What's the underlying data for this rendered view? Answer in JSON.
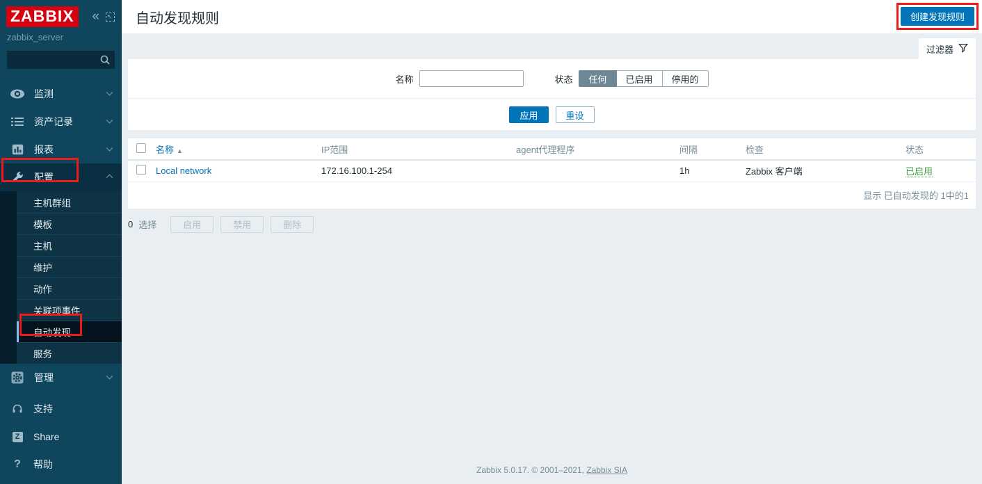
{
  "colors": {
    "sidebar_bg": "#10455e",
    "accent_blue": "#0275b8",
    "logo_red": "#d6000f",
    "annotation_red": "#ec1c1c",
    "enabled_green": "#429e42",
    "page_bg": "#e8eef1"
  },
  "sidebar": {
    "logo": "ZABBIX",
    "server_name": "zabbix_server",
    "items": [
      {
        "label": "监测"
      },
      {
        "label": "资产记录"
      },
      {
        "label": "报表"
      },
      {
        "label": "配置"
      },
      {
        "label": "管理"
      }
    ],
    "config_submenu": [
      {
        "label": "主机群组"
      },
      {
        "label": "模板"
      },
      {
        "label": "主机"
      },
      {
        "label": "维护"
      },
      {
        "label": "动作"
      },
      {
        "label": "关联项事件"
      },
      {
        "label": "自动发现"
      },
      {
        "label": "服务"
      }
    ],
    "footer_items": [
      {
        "label": "支持"
      },
      {
        "label": "Share"
      },
      {
        "label": "帮助"
      }
    ]
  },
  "header": {
    "title": "自动发现规则",
    "create_button": "创建发现规则"
  },
  "filter": {
    "tab_label": "过滤器",
    "name_label": "名称",
    "name_value": "",
    "status_label": "状态",
    "status_options": [
      {
        "label": "任何",
        "selected": true
      },
      {
        "label": "已启用",
        "selected": false
      },
      {
        "label": "停用的",
        "selected": false
      }
    ],
    "apply_label": "应用",
    "reset_label": "重设"
  },
  "table": {
    "columns": [
      "名称",
      "IP范围",
      "agent代理程序",
      "间隔",
      "检查",
      "状态"
    ],
    "sort_asc": "▲",
    "rows": [
      {
        "name": "Local network",
        "ip_range": "172.16.100.1-254",
        "agent": "",
        "interval": "1h",
        "checks": "Zabbix 客户端",
        "status": "已启用"
      }
    ],
    "summary": "显示 已自动发现的 1中的1"
  },
  "action_bar": {
    "selected_count": "0",
    "selected_label": "选择",
    "buttons": [
      {
        "label": "启用"
      },
      {
        "label": "禁用"
      },
      {
        "label": "删除"
      }
    ]
  },
  "footer": {
    "text": "Zabbix 5.0.17. © 2001–2021, ",
    "link": "Zabbix SIA"
  },
  "icons": {
    "collapse": "«",
    "expand": "↖",
    "share": "Z",
    "help": "?"
  }
}
